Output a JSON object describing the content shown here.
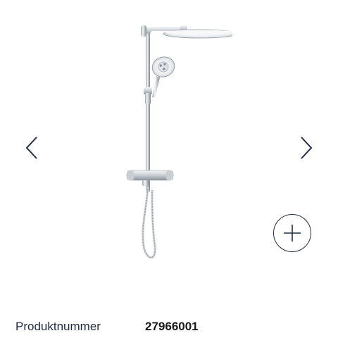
{
  "gallery": {
    "image_alt": "",
    "prev_icon": "chevron-left-icon",
    "next_icon": "chevron-right-icon",
    "zoom_icon": "plus-icon"
  },
  "product": {
    "number_label": "Produktnummer",
    "number_value": "27966001"
  },
  "colors": {
    "icon": "#1f2a44",
    "text": "#1f2a44",
    "chrome_light": "#eef0f2",
    "chrome_dark": "#9ba3ab"
  }
}
